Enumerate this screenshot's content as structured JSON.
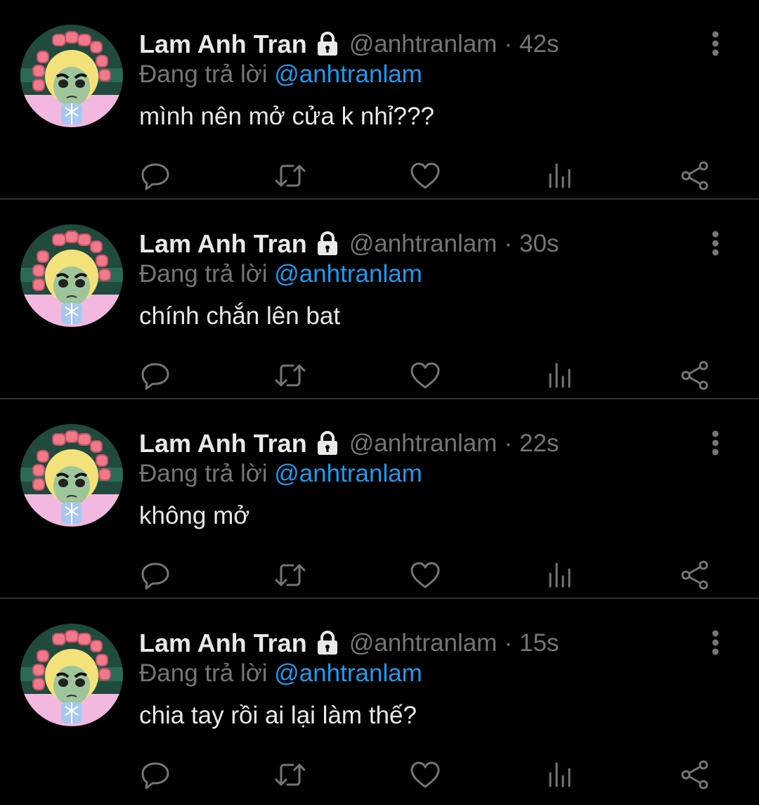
{
  "colors": {
    "background": "#000000",
    "divider": "#2f3336",
    "primary_text": "#e7e9ea",
    "secondary_text": "#71767b",
    "mention": "#1d9bf0"
  },
  "tweets": [
    {
      "name": "Lam Anh Tran",
      "handle": "@anhtranlam",
      "separator": "·",
      "time": "42s",
      "reply_prefix": "Đang trả lời",
      "reply_to": "@anhtranlam",
      "text": "mình nên mở cửa k nhỉ???",
      "icons": [
        "lock-icon",
        "more-icon",
        "reply-icon",
        "retweet-icon",
        "like-icon",
        "views-icon",
        "share-icon"
      ]
    },
    {
      "name": "Lam Anh Tran",
      "handle": "@anhtranlam",
      "separator": "·",
      "time": "30s",
      "reply_prefix": "Đang trả lời",
      "reply_to": "@anhtranlam",
      "text": "chính chắn lên bat",
      "icons": [
        "lock-icon",
        "more-icon",
        "reply-icon",
        "retweet-icon",
        "like-icon",
        "views-icon",
        "share-icon"
      ]
    },
    {
      "name": "Lam Anh Tran",
      "handle": "@anhtranlam",
      "separator": "·",
      "time": "22s",
      "reply_prefix": "Đang trả lời",
      "reply_to": "@anhtranlam",
      "text": "không mở",
      "icons": [
        "lock-icon",
        "more-icon",
        "reply-icon",
        "retweet-icon",
        "like-icon",
        "views-icon",
        "share-icon"
      ]
    },
    {
      "name": "Lam Anh Tran",
      "handle": "@anhtranlam",
      "separator": "·",
      "time": "15s",
      "reply_prefix": "Đang trả lời",
      "reply_to": "@anhtranlam",
      "text": "chia tay rồi ai lại làm thế?",
      "icons": [
        "lock-icon",
        "more-icon",
        "reply-icon",
        "retweet-icon",
        "like-icon",
        "views-icon",
        "share-icon"
      ]
    }
  ]
}
